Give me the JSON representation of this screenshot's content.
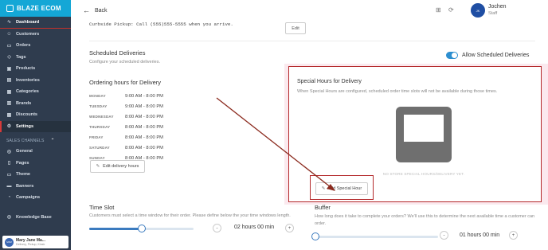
{
  "brand": {
    "name": "BLAZE ECOM"
  },
  "sidebar": {
    "items": [
      {
        "label": "Dashboard",
        "icon": "dashboard-icon",
        "glyph": "∿"
      },
      {
        "label": "Customers",
        "icon": "customers-icon",
        "glyph": "☺"
      },
      {
        "label": "Orders",
        "icon": "orders-icon",
        "glyph": "▭"
      },
      {
        "label": "Tags",
        "icon": "tags-icon",
        "glyph": "◇"
      },
      {
        "label": "Products",
        "icon": "products-icon",
        "glyph": "▣"
      },
      {
        "label": "Inventories",
        "icon": "inventories-icon",
        "glyph": "▤"
      },
      {
        "label": "Categories",
        "icon": "categories-icon",
        "glyph": "▦"
      },
      {
        "label": "Brands",
        "icon": "brands-icon",
        "glyph": "▥"
      },
      {
        "label": "Discounts",
        "icon": "discounts-icon",
        "glyph": "▩"
      },
      {
        "label": "Settings",
        "icon": "settings-icon",
        "glyph": "⚙"
      }
    ],
    "sales_channels_label": "SALES CHANNELS",
    "channel_items": [
      {
        "label": "General",
        "icon": "general-icon",
        "glyph": "◎"
      },
      {
        "label": "Pages",
        "icon": "pages-icon",
        "glyph": "▯"
      },
      {
        "label": "Theme",
        "icon": "theme-icon",
        "glyph": "▭"
      },
      {
        "label": "Banners",
        "icon": "banners-icon",
        "glyph": "▬"
      },
      {
        "label": "Campaigns",
        "icon": "campaigns-icon",
        "glyph": "◔"
      }
    ],
    "knowledge_base": "Knowledge Base",
    "user": {
      "name": "Mary Jane Ma...",
      "sub": "Delivery, Pickup, Kiosk",
      "initials": "MJM"
    }
  },
  "header": {
    "back_label": "Back",
    "user_name": "Jochen",
    "user_role": "Staff",
    "user_initials": "JK"
  },
  "curbside": {
    "text": "Curbside Pickup: Call (555)555-5555 when you arrive.",
    "edit_label": "Edit"
  },
  "scheduled": {
    "title": "Scheduled Deliveries",
    "subtitle": "Configure your scheduled deliveries.",
    "toggle_label": "Allow Scheduled Deliveries",
    "toggle_on": true
  },
  "ordering_hours": {
    "title": "Ordering hours for Delivery",
    "rows": [
      {
        "day": "MONDAY",
        "time": "9:00 AM - 8:00 PM"
      },
      {
        "day": "TUESDAY",
        "time": "9:00 AM - 8:00 PM"
      },
      {
        "day": "WEDNESDAY",
        "time": "8:00 AM - 8:00 PM"
      },
      {
        "day": "THURSDAY",
        "time": "8:00 AM - 8:00 PM"
      },
      {
        "day": "FRIDAY",
        "time": "8:00 AM - 8:00 PM"
      },
      {
        "day": "SATURDAY",
        "time": "8:00 AM - 8:00 PM"
      },
      {
        "day": "SUNDAY",
        "time": "8:00 AM - 8:00 PM"
      }
    ],
    "edit_label": "Edit delivery hours"
  },
  "special_hours": {
    "title": "Special Hours for Delivery",
    "subtitle": "When Special Hours are configured, scheduled order time slots will not be available during those times.",
    "empty_text": "NO STORE SPECIAL HOURS/DELIVERY YET.",
    "add_label": "Add Special Hour"
  },
  "time_slot": {
    "title": "Time Slot",
    "subtitle": "Customers must select a time window for their order. Please define below the your time windows length.",
    "value": "02 hours 00 min",
    "slider_fraction": 0.5
  },
  "buffer": {
    "title": "Buffer",
    "subtitle": "How long does it take to complete your orders? We'll use this to determine the next available time a customer can order.",
    "value": "01 hours 00 min",
    "slider_fraction": 0.0
  },
  "colors": {
    "accent": "#14a7d6",
    "sidebar": "#2f3c4e",
    "highlight": "#b4292b"
  }
}
